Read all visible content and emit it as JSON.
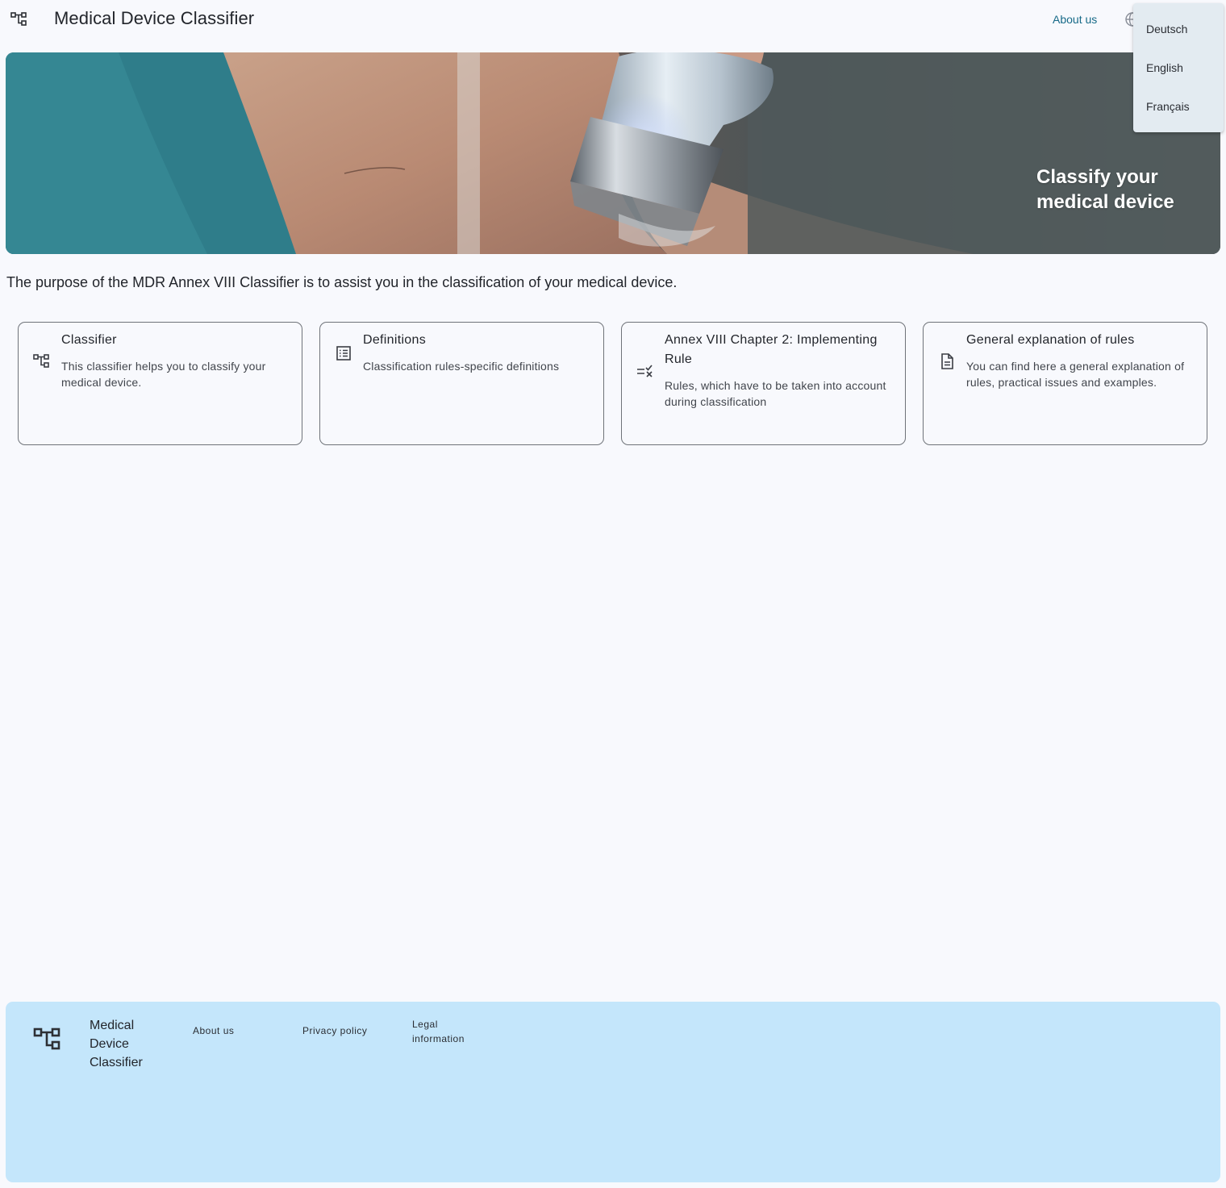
{
  "header": {
    "title": "Medical Device Classifier",
    "about_label": "About us",
    "logo_icon": "classifier-tree-icon",
    "language_icon": "globe-icon"
  },
  "language_menu": {
    "items": [
      {
        "label": "Deutsch"
      },
      {
        "label": "English"
      },
      {
        "label": "Français"
      }
    ]
  },
  "hero": {
    "heading_line1": "Classify your",
    "heading_line2": "medical device"
  },
  "intro": {
    "text": "The purpose of the MDR Annex VIII Classifier is to assist you in the classification of your medical device."
  },
  "cards": [
    {
      "icon": "classifier-tree-icon",
      "title": "Classifier",
      "description": "This classifier helps you to classify your medical device."
    },
    {
      "icon": "list-icon",
      "title": "Definitions",
      "description": "Classification rules-specific definitions"
    },
    {
      "icon": "rule-check-icon",
      "title": "Annex VIII Chapter 2: Implementing Rule",
      "description": "Rules, which have to be taken into account during classification"
    },
    {
      "icon": "document-icon",
      "title": "General explanation of rules",
      "description": "You can find here a general explanation of rules, practical issues and examples."
    }
  ],
  "footer": {
    "title_line1": "Medical",
    "title_line2": "Device",
    "title_line3": "Classifier",
    "about_label": "About us",
    "privacy_label": "Privacy policy",
    "legal_line1": "Legal",
    "legal_line2": "information"
  },
  "colors": {
    "background": "#f8f9fd",
    "accent_link": "#176a88",
    "footer_background": "#c4e6fb",
    "menu_background": "#e3ebf1"
  }
}
